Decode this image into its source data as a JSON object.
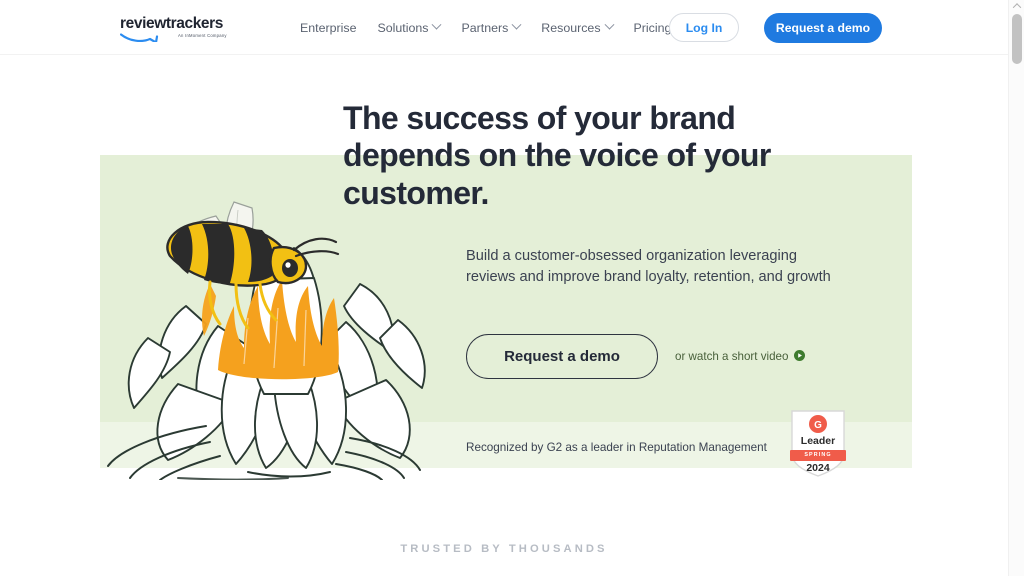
{
  "header": {
    "logo": {
      "wordmark": "reviewtrackers",
      "tagline": "An InMoment Company",
      "swoosh_color": "#2b8cf0"
    },
    "nav": [
      {
        "label": "Enterprise",
        "has_dropdown": false
      },
      {
        "label": "Solutions",
        "has_dropdown": true
      },
      {
        "label": "Partners",
        "has_dropdown": true
      },
      {
        "label": "Resources",
        "has_dropdown": true
      },
      {
        "label": "Pricing",
        "has_dropdown": false
      }
    ],
    "login_label": "Log In",
    "demo_label": "Request a demo",
    "login_color": "#2b8cf0",
    "demo_bg": "#1f7ae0"
  },
  "hero": {
    "headline": "The success of your brand depends on the voice of your customer.",
    "subheading": "Build a customer-obsessed organization leveraging reviews and improve brand loyalty, retention, and growth",
    "cta_label": "Request a demo",
    "watch_video_label": "or watch a short video",
    "watch_video_icon": "play-circle-icon",
    "recognized_text": "Recognized by G2 as a leader in Reputation Management",
    "illustration_name": "bee-on-lotus-illustration",
    "bg_color": "#e4efd7",
    "band_color": "#eef5e6"
  },
  "g2_badge": {
    "mark": "G2",
    "leader": "Leader",
    "season": "SPRING",
    "year": "2024",
    "ribbon_color": "#f05c4a"
  },
  "trusted": {
    "label": "TRUSTED BY THOUSANDS"
  },
  "scrollbar": {
    "position": "right",
    "thumb_color": "#c2c2c2"
  }
}
